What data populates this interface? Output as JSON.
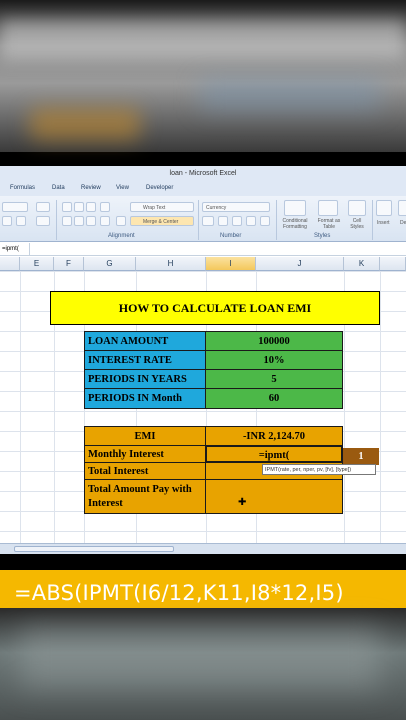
{
  "window": {
    "title": "loan - Microsoft Excel"
  },
  "menu": [
    "Formulas",
    "Data",
    "Review",
    "View",
    "Developer"
  ],
  "ribbon": {
    "wrap_text": "Wrap Text",
    "merge_center": "Merge & Center",
    "number_format": "Currency",
    "conditional_formatting": "Conditional Formatting",
    "format_as_table": "Format as Table",
    "cell_styles": "Cell Styles",
    "insert": "Insert",
    "delete": "De",
    "group_alignment": "Alignment",
    "group_number": "Number",
    "group_styles": "Styles"
  },
  "formula_bar": {
    "name_box": "=ipmt("
  },
  "columns": [
    "E",
    "F",
    "G",
    "H",
    "I",
    "J",
    "K"
  ],
  "sheet": {
    "title": "HOW TO CALCULATE LOAN EMI",
    "inputs": [
      {
        "label": "LOAN AMOUNT",
        "value": "100000"
      },
      {
        "label": "INTEREST RATE",
        "value": "10%"
      },
      {
        "label": "PERIODS IN YEARS",
        "value": "5"
      },
      {
        "label": "PERIODS IN Month",
        "value": "60"
      }
    ],
    "results": [
      {
        "label": "EMI",
        "value": "-INR 2,124.70"
      },
      {
        "label": "Monthly Interest",
        "value": "=ipmt("
      },
      {
        "label": "Total Interest",
        "value": ""
      },
      {
        "label": "Total Amount Pay with Interest",
        "value": ""
      }
    ],
    "k_cell": "1",
    "tooltip": "IPMT(rate, per, nper, pv, [fv], [type])"
  },
  "caption": "=ABS(IPMT(I6/12,K11,I8*12,I5)",
  "colors": {
    "title_bg": "#ffff00",
    "label_bg": "#1fa8dc",
    "value_bg": "#4cb848",
    "result_bg": "#e8a300",
    "caption_bg": "#f5b800"
  }
}
